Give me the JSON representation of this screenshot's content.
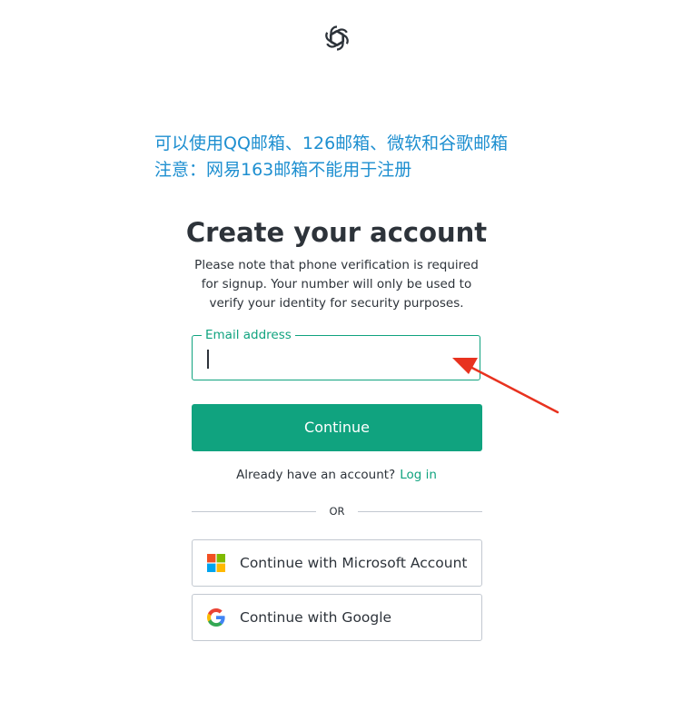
{
  "notice": {
    "line1": "可以使用QQ邮箱、126邮箱、微软和谷歌邮箱",
    "line2": "注意：网易163邮箱不能用于注册"
  },
  "auth": {
    "title": "Create your account",
    "subtitle": "Please note that phone verification is required for signup. Your number will only be used to verify your identity for security purposes.",
    "email_label": "Email address",
    "email_value": "",
    "continue_label": "Continue",
    "login_prompt": "Already have an account?",
    "login_link": "Log in",
    "divider_text": "OR",
    "microsoft_label": "Continue with Microsoft Account",
    "google_label": "Continue with Google"
  },
  "icons": {
    "logo": "openai-logo-icon",
    "arrow": "red-arrow-annotation",
    "microsoft": "microsoft-icon",
    "google": "google-icon"
  },
  "colors": {
    "accent": "#10a37f",
    "notice_text": "#1e8fd0",
    "annotation_arrow": "#e8321f",
    "border": "#c2c8d0",
    "text": "#2d333a"
  }
}
